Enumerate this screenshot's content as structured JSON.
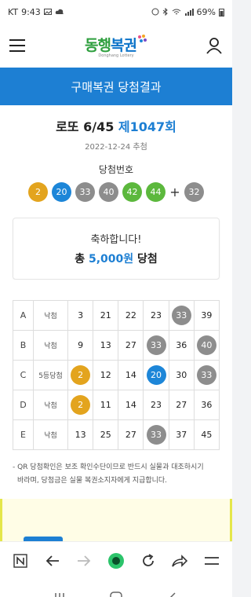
{
  "status_bar": {
    "carrier": "KT",
    "time": "9:43",
    "battery": "69%"
  },
  "header": {
    "logo_text_a": "동행",
    "logo_text_b": "복권",
    "logo_sub": "Donghang Lottery"
  },
  "title_bar": {
    "title": "구매복권 당첨결과"
  },
  "draw": {
    "game": "로또 6/45",
    "round": "제1047회",
    "date": "2022-12-24 추첨",
    "win_label": "당첨번호",
    "numbers": [
      "2",
      "20",
      "33",
      "40",
      "42",
      "44"
    ],
    "plus": "+",
    "bonus": "32"
  },
  "colors": {
    "yellow": "#e3a41e",
    "blue": "#1d86d8",
    "gray": "#8d8d8d",
    "green": "#5cb83d",
    "accent": "#1d7fd3"
  },
  "ball_colors": [
    "yellow",
    "blue",
    "gray",
    "gray",
    "green",
    "green"
  ],
  "bonus_color": "gray",
  "result": {
    "congrats": "축하합니다!",
    "prize_prefix": "총",
    "prize_amount": "5,000원",
    "prize_suffix": "당첨"
  },
  "tickets": [
    {
      "label": "A",
      "result": "낙첨",
      "numbers": [
        "3",
        "21",
        "22",
        "23",
        "33",
        "39"
      ],
      "hits": [
        "",
        "",
        "",
        "",
        "gray",
        ""
      ]
    },
    {
      "label": "B",
      "result": "낙첨",
      "numbers": [
        "9",
        "13",
        "27",
        "33",
        "36",
        "40"
      ],
      "hits": [
        "",
        "",
        "",
        "gray",
        "",
        "gray"
      ]
    },
    {
      "label": "C",
      "result": "5등당첨",
      "numbers": [
        "2",
        "12",
        "14",
        "20",
        "30",
        "33"
      ],
      "hits": [
        "yellow",
        "",
        "",
        "blue",
        "",
        "gray"
      ]
    },
    {
      "label": "D",
      "result": "낙첨",
      "numbers": [
        "2",
        "11",
        "14",
        "23",
        "27",
        "36"
      ],
      "hits": [
        "yellow",
        "",
        "",
        "",
        "",
        ""
      ]
    },
    {
      "label": "E",
      "result": "낙첨",
      "numbers": [
        "13",
        "25",
        "27",
        "33",
        "37",
        "45"
      ],
      "hits": [
        "",
        "",
        "",
        "gray",
        "",
        ""
      ]
    }
  ],
  "notice": {
    "line1": "- QR 당첨확인은 보조 확인수단이므로 반드시 실물과 대조하시기",
    "line2": "바라며, 당첨금은 실물 복권소지자에게 지급합니다."
  },
  "browser_bar": {
    "icons": [
      "naver-n-icon",
      "back-arrow-icon",
      "forward-arrow-icon",
      "home-dot-icon",
      "refresh-icon",
      "share-icon",
      "menu-icon"
    ]
  }
}
